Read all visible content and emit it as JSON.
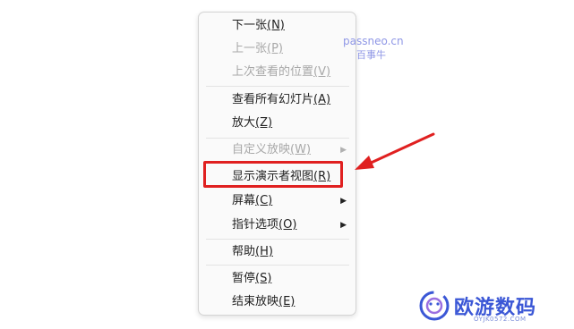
{
  "menu": {
    "items": [
      {
        "label": "下一张",
        "key": "(N)",
        "enabled": true
      },
      {
        "label": "上一张",
        "key": "(P)",
        "enabled": false
      },
      {
        "label": "上次查看的位置",
        "key": "(V)",
        "enabled": false
      },
      {
        "label": "查看所有幻灯片",
        "key": "(A)",
        "enabled": true
      },
      {
        "label": "放大",
        "key": "(Z)",
        "enabled": true
      },
      {
        "label": "自定义放映",
        "key": "(W)",
        "enabled": false,
        "submenu_icon": "chevron-right-icon"
      },
      {
        "label": "显示演示者视图",
        "key": "(R)",
        "enabled": true,
        "highlighted": true
      },
      {
        "label": "屏幕",
        "key": "(C)",
        "enabled": true,
        "submenu_icon": "chevron-right-icon"
      },
      {
        "label": "指针选项",
        "key": "(O)",
        "enabled": true,
        "submenu_icon": "chevron-right-icon"
      },
      {
        "label": "帮助",
        "key": "(H)",
        "enabled": true
      },
      {
        "label": "暂停",
        "key": "(S)",
        "enabled": true
      },
      {
        "label": "结束放映",
        "key": "(E)",
        "enabled": true
      }
    ]
  },
  "watermark": {
    "line1": "passneo.cn",
    "line2": "百事牛"
  },
  "logo": {
    "text": "欧游数码",
    "subtext": "OYJK0572.COM"
  },
  "colors": {
    "highlight": "#e02020",
    "arrow": "#e02020",
    "logo": "#3b57d6",
    "watermark": "#8f97e6"
  }
}
